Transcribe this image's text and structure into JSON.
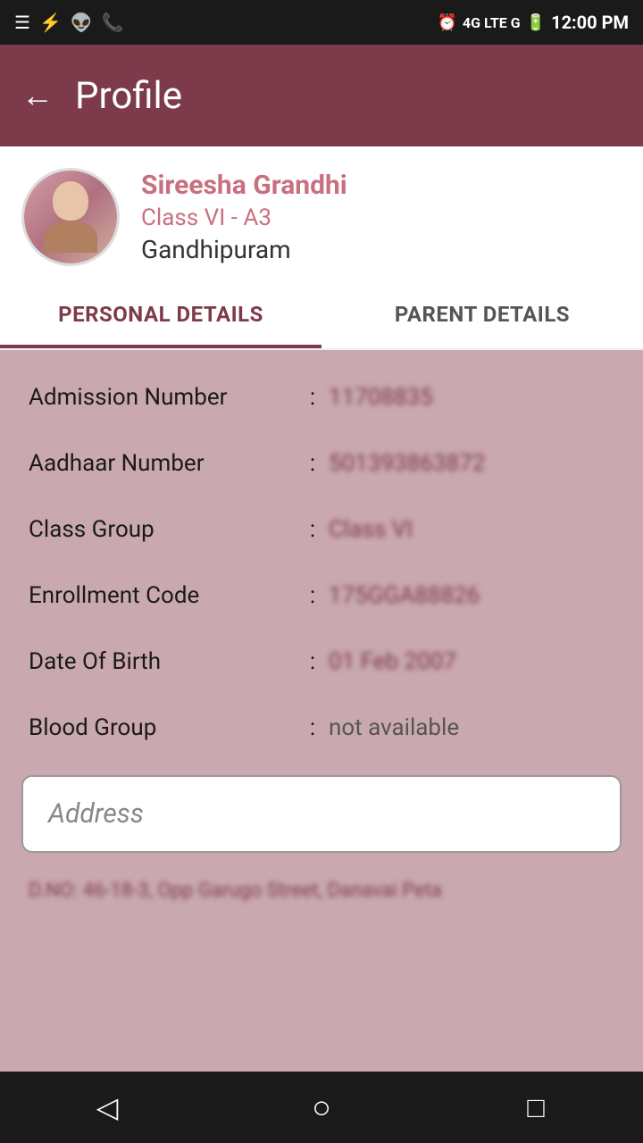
{
  "statusBar": {
    "time": "12:00 PM",
    "network": "4G LTE G",
    "battery": "charging"
  },
  "appBar": {
    "backLabel": "←",
    "title": "Profile"
  },
  "profile": {
    "name": "Sireesha  Grandhi",
    "class": "Class VI - A3",
    "location": "Gandhipuram"
  },
  "tabs": [
    {
      "id": "personal",
      "label": "PERSONAL DETAILS",
      "active": true
    },
    {
      "id": "parent",
      "label": "PARENT DETAILS",
      "active": false
    }
  ],
  "personalDetails": {
    "fields": [
      {
        "label": "Admission Number",
        "colon": ":",
        "value": "11708835"
      },
      {
        "label": "Aadhaar Number",
        "colon": ":",
        "value": "501393863872"
      },
      {
        "label": "Class Group",
        "colon": ":",
        "value": "Class VI"
      },
      {
        "label": "Enrollment Code",
        "colon": ":",
        "value": "175GGA88826"
      },
      {
        "label": "Date Of Birth",
        "colon": ":",
        "value": "01 Feb 2007"
      },
      {
        "label": "Blood Group",
        "colon": ":",
        "value": "not available"
      }
    ],
    "addressLabel": "Address",
    "addressValue": "D.NO: 46-18-3, Opp Garugo Street, Danavai Peta"
  },
  "bottomNav": {
    "back": "◁",
    "home": "○",
    "recent": "□"
  }
}
